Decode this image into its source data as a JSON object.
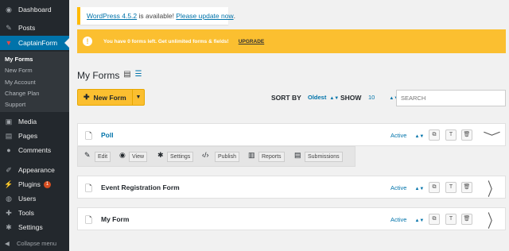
{
  "sidebar": {
    "items": [
      {
        "label": "Dashboard",
        "icon": "dashboard-icon",
        "glyph": "◉"
      },
      {
        "label": "Posts",
        "icon": "pin-icon",
        "glyph": "✎"
      },
      {
        "label": "CaptainForm",
        "icon": "captainform-icon",
        "glyph": "▼"
      },
      {
        "label": "Media",
        "icon": "media-icon",
        "glyph": "▣"
      },
      {
        "label": "Pages",
        "icon": "page-icon",
        "glyph": "▤"
      },
      {
        "label": "Comments",
        "icon": "comment-icon",
        "glyph": "●"
      },
      {
        "label": "Appearance",
        "icon": "brush-icon",
        "glyph": "✐"
      },
      {
        "label": "Plugins",
        "icon": "plugin-icon",
        "glyph": "⚡",
        "badge": "1"
      },
      {
        "label": "Users",
        "icon": "users-icon",
        "glyph": "◍"
      },
      {
        "label": "Tools",
        "icon": "wrench-icon",
        "glyph": "✚"
      },
      {
        "label": "Settings",
        "icon": "settings-icon",
        "glyph": "✱"
      }
    ],
    "submenu": [
      "My Forms",
      "New Form",
      "My Account",
      "Change Plan",
      "Support"
    ],
    "collapse_label": "Collapse menu"
  },
  "notice": {
    "version_link": "WordPress 4.5.2",
    "middle": " is available! ",
    "update_link": "Please update now",
    "end": "."
  },
  "banner": {
    "text": "You have 0 forms left. Get unlimited forms & fields!",
    "upgrade": "UPGRADE",
    "color": "#fbbf30"
  },
  "page": {
    "title": "My Forms",
    "new_form": "New Form",
    "sort_by_label": "SORT BY",
    "sort_value": "Oldest",
    "show_label": "SHOW",
    "show_value": "10",
    "search_placeholder": "SEARCH"
  },
  "forms": [
    {
      "name": "Poll",
      "status": "Active"
    },
    {
      "name": "Event Registration Form",
      "status": "Active"
    },
    {
      "name": "My Form",
      "status": "Active"
    }
  ],
  "actions": [
    "Edit",
    "View",
    "Settings",
    "Publish",
    "Reports",
    "Submissions"
  ]
}
